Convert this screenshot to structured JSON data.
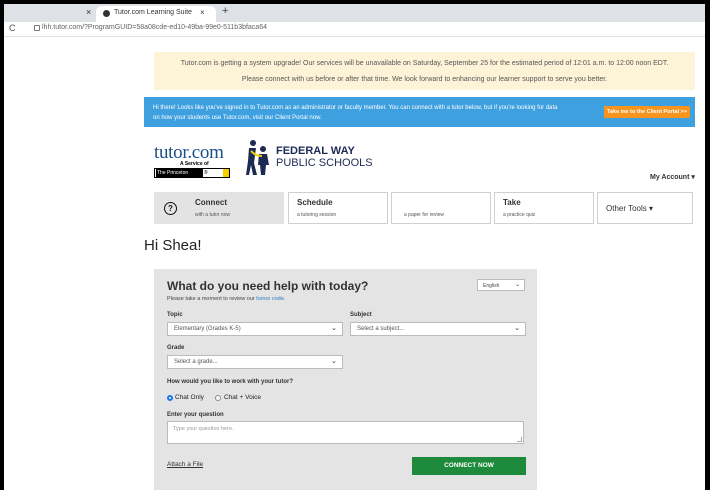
{
  "browser": {
    "tab_title": "Tutor.com Learning Suite",
    "url": "lhh.tutor.com/?ProgramGUID=58a08cde-ed10-49ba-99e0-511b3bfaca64",
    "new_tab": "+",
    "close": "×",
    "reload": "C"
  },
  "notice": {
    "line1": "Tutor.com is getting a system upgrade! Our services will be unavailable on Saturday, September 25 for the estimated period of 12:01 a.m. to 12:00 noon EDT.",
    "line2": "Please connect with us before or after that time. We look forward to enhancing our learner support to serve you better."
  },
  "banner": {
    "line1": "Hi there! Looks like you've signed in to Tutor.com as an administrator or faculty member. You can connect with a tutor below, but if you're looking for data",
    "line2": "on how your students use Tutor.com, visit our Client Portal now.",
    "portal_button": "Take me to the Client Portal >>"
  },
  "logos": {
    "tutor": "tutor.com",
    "service": "A Service of",
    "princeton": "The Princeton Review",
    "princeton_mark": "®",
    "fw_title": "FEDERAL WAY",
    "fw_sub": "PUBLIC SCHOOLS"
  },
  "account": "My Account ▾",
  "nav": {
    "connect": {
      "label": "Connect",
      "sub": "with a tutor now",
      "icon": "?"
    },
    "schedule": {
      "label": "Schedule",
      "sub": "a tutoring session"
    },
    "review": {
      "label": "",
      "sub": "a paper for review"
    },
    "take": {
      "label": "Take",
      "sub": "a practice quiz"
    },
    "other": {
      "label": "Other Tools ▾"
    }
  },
  "greeting": "Hi Shea!",
  "form": {
    "title": "What do you need help with today?",
    "language": "English",
    "honor_prefix": "Please take a moment to review our ",
    "honor_link": "honor code.",
    "topic_label": "Topic",
    "topic_value": "Elementary (Grades K-5)",
    "subject_label": "Subject",
    "subject_placeholder": "Select a subject...",
    "grade_label": "Grade",
    "grade_placeholder": "Select a grade...",
    "work_label": "How would you like to work with your tutor?",
    "mode_chat": "Chat Only",
    "mode_voice": "Chat + Voice",
    "selected_mode": "Chat Only",
    "question_label": "Enter your question",
    "question_placeholder": "Type your question here.",
    "attach": "Attach a File",
    "connect_button": "CONNECT NOW"
  },
  "colors": {
    "notice_bg": "#fdf3d7",
    "banner_bg": "#3ea0df",
    "portal_button": "#f7941e",
    "connect_button": "#1e8a3c",
    "panel_bg": "#e4e4e4"
  }
}
